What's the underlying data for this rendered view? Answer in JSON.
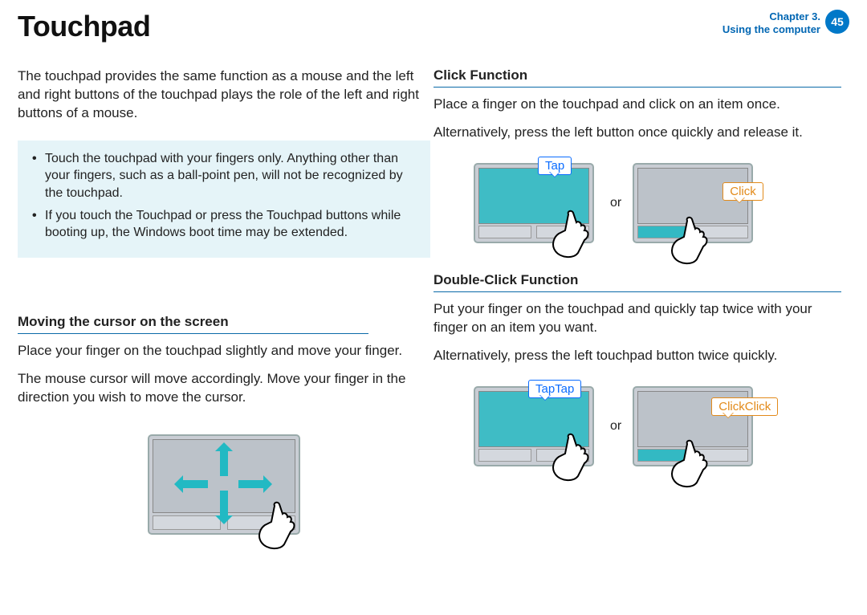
{
  "header": {
    "title": "Touchpad",
    "chapter_line1": "Chapter 3.",
    "chapter_line2": "Using the computer",
    "page_number": "45"
  },
  "left": {
    "intro": "The touchpad provides the same function as a mouse and the left and right buttons of the touchpad plays the role of the left and right buttons of a mouse.",
    "note1": "Touch the touchpad with your ﬁngers only. Anything other than your ﬁngers, such as a ball-point pen, will not be recognized by the touchpad.",
    "note2": "If you touch the Touchpad or press the Touchpad buttons while booting up, the Windows boot time may be extended.",
    "section_h": "Moving the cursor on the screen",
    "p1": "Place your ﬁnger on the touchpad slightly and move your ﬁnger.",
    "p2": "The mouse cursor will move accordingly. Move your ﬁnger in the direction you wish to move the cursor."
  },
  "right": {
    "click_h": "Click Function",
    "click_p1": "Place a ﬁnger on the touchpad and click on an item once.",
    "click_p2": "Alternatively, press the left button once quickly and release it.",
    "tap_label": "Tap",
    "click_label": "Click",
    "or_label": "or",
    "dbl_h": "Double-Click Function",
    "dbl_p1": "Put your ﬁnger on the touchpad and quickly tap twice with your ﬁnger on an item you want.",
    "dbl_p2": "Alternatively, press the left touchpad button twice quickly.",
    "taptap_label": "TapTap",
    "clickclick_label": "ClickClick"
  }
}
